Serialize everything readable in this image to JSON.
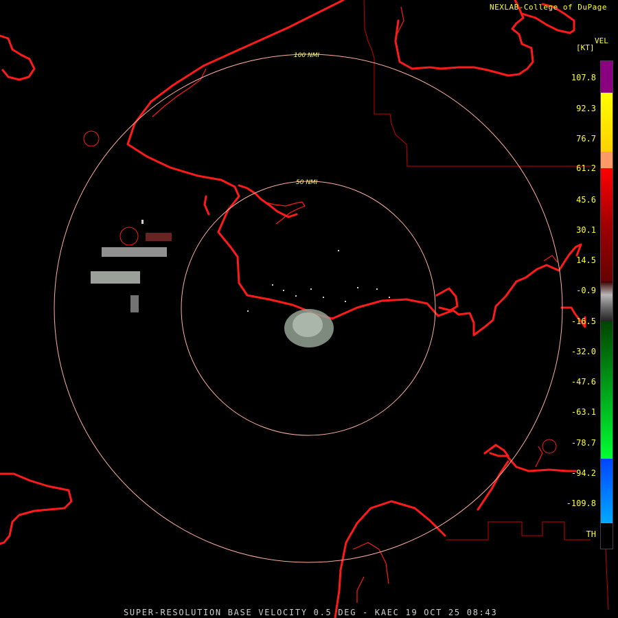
{
  "credit": "NEXLAB-College of DuPage",
  "footer": "SUPER-RESOLUTION BASE VELOCITY 0.5 DEG - KAEC 19 OCT 25 08:43",
  "legend": {
    "title": "VEL",
    "unit": "[KT]",
    "ticks": [
      "107.8",
      "92.3",
      "76.7",
      "61.2",
      "45.6",
      "30.1",
      "14.5",
      "-0.9",
      "-16.5",
      "-32.0",
      "-47.6",
      "-63.1",
      "-78.7",
      "-94.2",
      "-109.8",
      "TH"
    ],
    "colors": {
      "purple": "#8b0080",
      "yellow": "#ffff00",
      "orange": "#ff9966",
      "red": "#ff0000",
      "dark_red": "#660000",
      "gray": "#b8b8b8",
      "green": "#00ff33",
      "dark_green": "#004400",
      "blue": "#0066ff",
      "light_blue": "#00aaff",
      "black": "#000000"
    }
  },
  "map": {
    "range_rings": [
      {
        "label": "50 NMI"
      },
      {
        "label": "100 NMI"
      }
    ],
    "colors": {
      "coastline": "#ff1a1a",
      "ring": "#ffb0a0",
      "echo": "#9aa59a"
    }
  }
}
